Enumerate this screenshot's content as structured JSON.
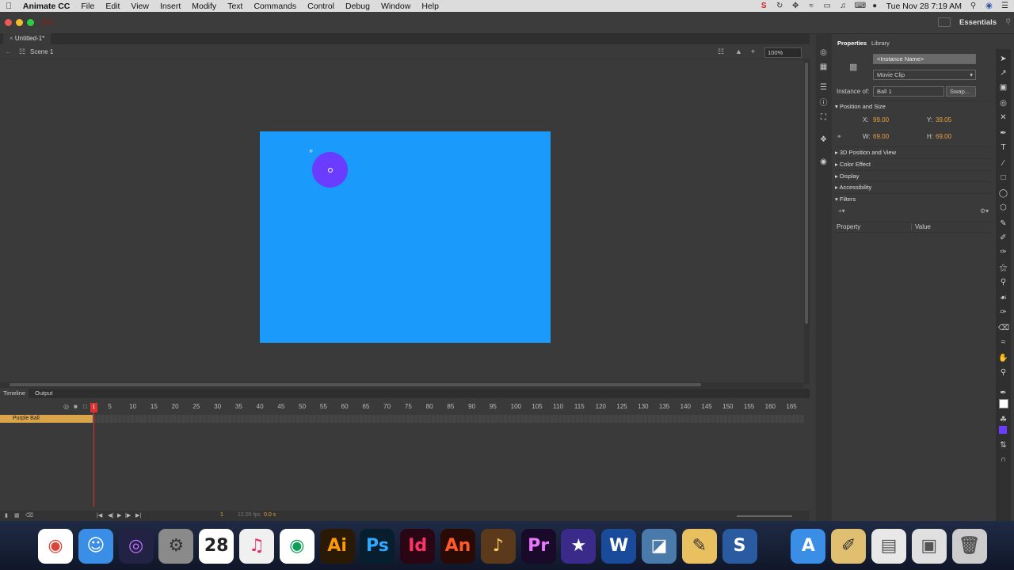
{
  "menubar": {
    "app_name": "Animate CC",
    "items": [
      "File",
      "Edit",
      "View",
      "Insert",
      "Modify",
      "Text",
      "Commands",
      "Control",
      "Debug",
      "Window",
      "Help"
    ],
    "clock": "Tue Nov 28  7:19 AM",
    "status_icons": [
      "s-icon",
      "sync-icon",
      "move-icon",
      "wifi-icon",
      "screen-icon",
      "volume-icon",
      "keyboard-icon",
      "user-icon",
      "search-icon",
      "avatar-icon",
      "list-icon"
    ]
  },
  "app": {
    "logo": "An",
    "workspace": "Essentials"
  },
  "document": {
    "tab": "Untitled-1*",
    "scene": "Scene 1",
    "zoom": "100%"
  },
  "stage": {
    "color": "#1a9bfc",
    "ball_color": "#6a3cff"
  },
  "timeline": {
    "tabs": [
      "Timeline",
      "Output"
    ],
    "layer_name": "Purple Ball",
    "current_frame": "1",
    "frame_labels": [
      "5",
      "10",
      "15",
      "20",
      "25",
      "30",
      "35",
      "40",
      "45",
      "50",
      "55",
      "60",
      "65",
      "70",
      "75",
      "80",
      "85",
      "90",
      "95",
      "100",
      "105",
      "110",
      "115",
      "120",
      "125",
      "130",
      "135",
      "140",
      "145",
      "150",
      "155",
      "160",
      "165"
    ],
    "fps": "12.00 fps",
    "time": "0.0 s",
    "frame_readout": "1"
  },
  "properties": {
    "tabs": [
      "Properties",
      "Library"
    ],
    "instance_name_placeholder": "<Instance Name>",
    "symbol_type": "Movie Clip",
    "instance_of_label": "Instance of:",
    "instance_of": "Ball 1",
    "swap_label": "Swap...",
    "position_size": "Position and Size",
    "x_label": "X:",
    "x": "99.00",
    "y_label": "Y:",
    "y": "39.05",
    "w_label": "W:",
    "w": "69.00",
    "h_label": "H:",
    "h": "69.00",
    "sections": [
      "3D Position and View",
      "Color Effect",
      "Display",
      "Accessibility",
      "Filters"
    ],
    "filters_cols": [
      "Property",
      "Value"
    ]
  },
  "dock": {
    "apps": [
      {
        "name": "chrome",
        "label": "◉",
        "bg": "#ffffff",
        "fg": "#db4437"
      },
      {
        "name": "finder",
        "label": "☺",
        "bg": "#3a8ee6",
        "fg": "#ffffff"
      },
      {
        "name": "siri",
        "label": "◎",
        "bg": "#222244",
        "fg": "#c070ff"
      },
      {
        "name": "system-preferences",
        "label": "⚙",
        "bg": "#8a8a8a",
        "fg": "#333333"
      },
      {
        "name": "calendar",
        "label": "28",
        "bg": "#ffffff",
        "fg": "#222222"
      },
      {
        "name": "itunes",
        "label": "♫",
        "bg": "#f0f0f0",
        "fg": "#e0306a"
      },
      {
        "name": "chrome-2",
        "label": "◉",
        "bg": "#ffffff",
        "fg": "#0f9d58"
      },
      {
        "name": "illustrator",
        "label": "Ai",
        "bg": "#2a1a05",
        "fg": "#ff9a00"
      },
      {
        "name": "photoshop",
        "label": "Ps",
        "bg": "#061e2e",
        "fg": "#31a8ff"
      },
      {
        "name": "indesign",
        "label": "Id",
        "bg": "#2a0514",
        "fg": "#ff3366"
      },
      {
        "name": "animate",
        "label": "An",
        "bg": "#2a0a05",
        "fg": "#ff5a2a"
      },
      {
        "name": "garageband",
        "label": "♪",
        "bg": "#5a3a1a",
        "fg": "#ffcc66"
      },
      {
        "name": "premiere",
        "label": "Pr",
        "bg": "#1a0a2a",
        "fg": "#ea77ff"
      },
      {
        "name": "imovie",
        "label": "★",
        "bg": "#3a2a8a",
        "fg": "#ffffff"
      },
      {
        "name": "word",
        "label": "W",
        "bg": "#1a4a9a",
        "fg": "#ffffff"
      },
      {
        "name": "preview",
        "label": "◪",
        "bg": "#4a7aaa",
        "fg": "#ffffff"
      },
      {
        "name": "notes",
        "label": "✎",
        "bg": "#e8c060",
        "fg": "#333333"
      },
      {
        "name": "snagit",
        "label": "S",
        "bg": "#2a5aa0",
        "fg": "#ffffff"
      },
      {
        "name": "app-store",
        "label": "A",
        "bg": "#3a8ee6",
        "fg": "#ffffff"
      },
      {
        "name": "script-editor",
        "label": "✐",
        "bg": "#e0c070",
        "fg": "#333333"
      },
      {
        "name": "document",
        "label": "▤",
        "bg": "#e8e8e8",
        "fg": "#555555"
      },
      {
        "name": "window",
        "label": "▣",
        "bg": "#e0e0e0",
        "fg": "#555555"
      },
      {
        "name": "trash",
        "label": "🗑",
        "bg": "#cccccc",
        "fg": "#555555"
      }
    ]
  }
}
